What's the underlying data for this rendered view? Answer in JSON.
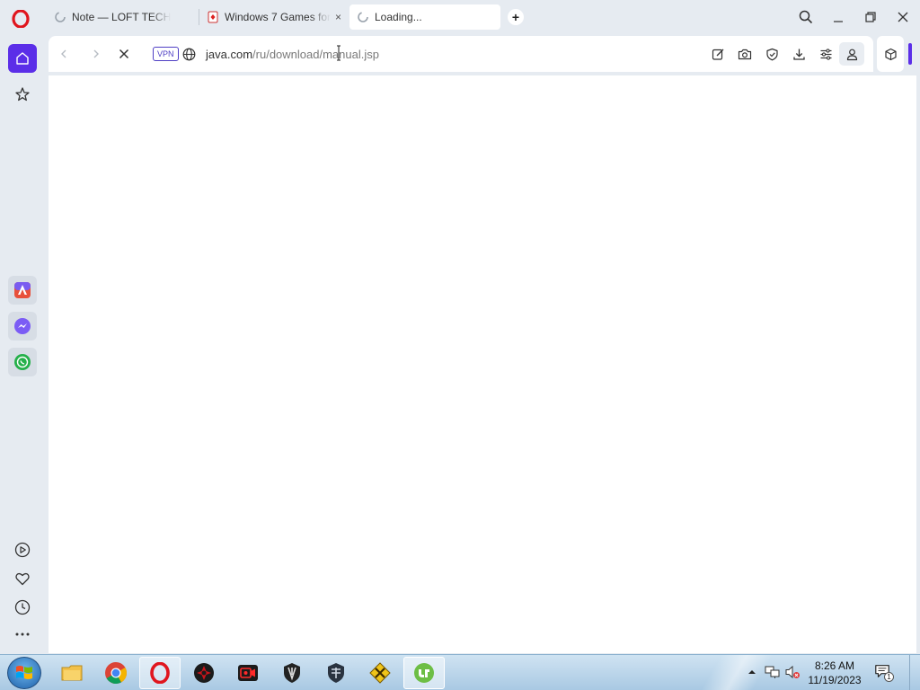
{
  "tabs": [
    {
      "title": "Note — LOFT TECH",
      "state": "loading"
    },
    {
      "title": "Windows 7 Games for",
      "state": "loaded",
      "close": "×"
    },
    {
      "title": "Loading...",
      "state": "loading",
      "active": true
    }
  ],
  "new_tab_label": "+",
  "window_controls": [
    "search-icon",
    "minimize-icon",
    "restore-icon",
    "close-icon"
  ],
  "sidebar": {
    "top": [
      "home-icon",
      "bookmarks-icon"
    ],
    "apps": [
      "aria-icon",
      "messenger-icon",
      "whatsapp-icon"
    ],
    "bottom": [
      "player-icon",
      "heart-icon",
      "history-icon",
      "more-icon"
    ]
  },
  "address_bar": {
    "vpn_label": "VPN",
    "url_domain": "java.com",
    "url_path": "/ru/download/manual.jsp"
  },
  "toolbar_icons": [
    "snapshot-edit-icon",
    "camera-icon",
    "shield-icon",
    "download-icon",
    "easy-setup-icon",
    "profile-icon",
    "extensions-icon"
  ],
  "taskbar": {
    "items": [
      "file-explorer",
      "chrome",
      "opera",
      "game-1",
      "screen-recorder",
      "world-of-tanks",
      "world-of-warships",
      "game-2",
      "utorrent"
    ],
    "tray": [
      "show-hidden-icons",
      "network-icon",
      "volume-icon"
    ],
    "time": "8:26 AM",
    "date": "11/19/2023",
    "notification_count": "1"
  },
  "colors": {
    "accent": "#5b2ee8",
    "opera_red": "#e0161e",
    "chrome_frame": "#e6ebf1"
  }
}
